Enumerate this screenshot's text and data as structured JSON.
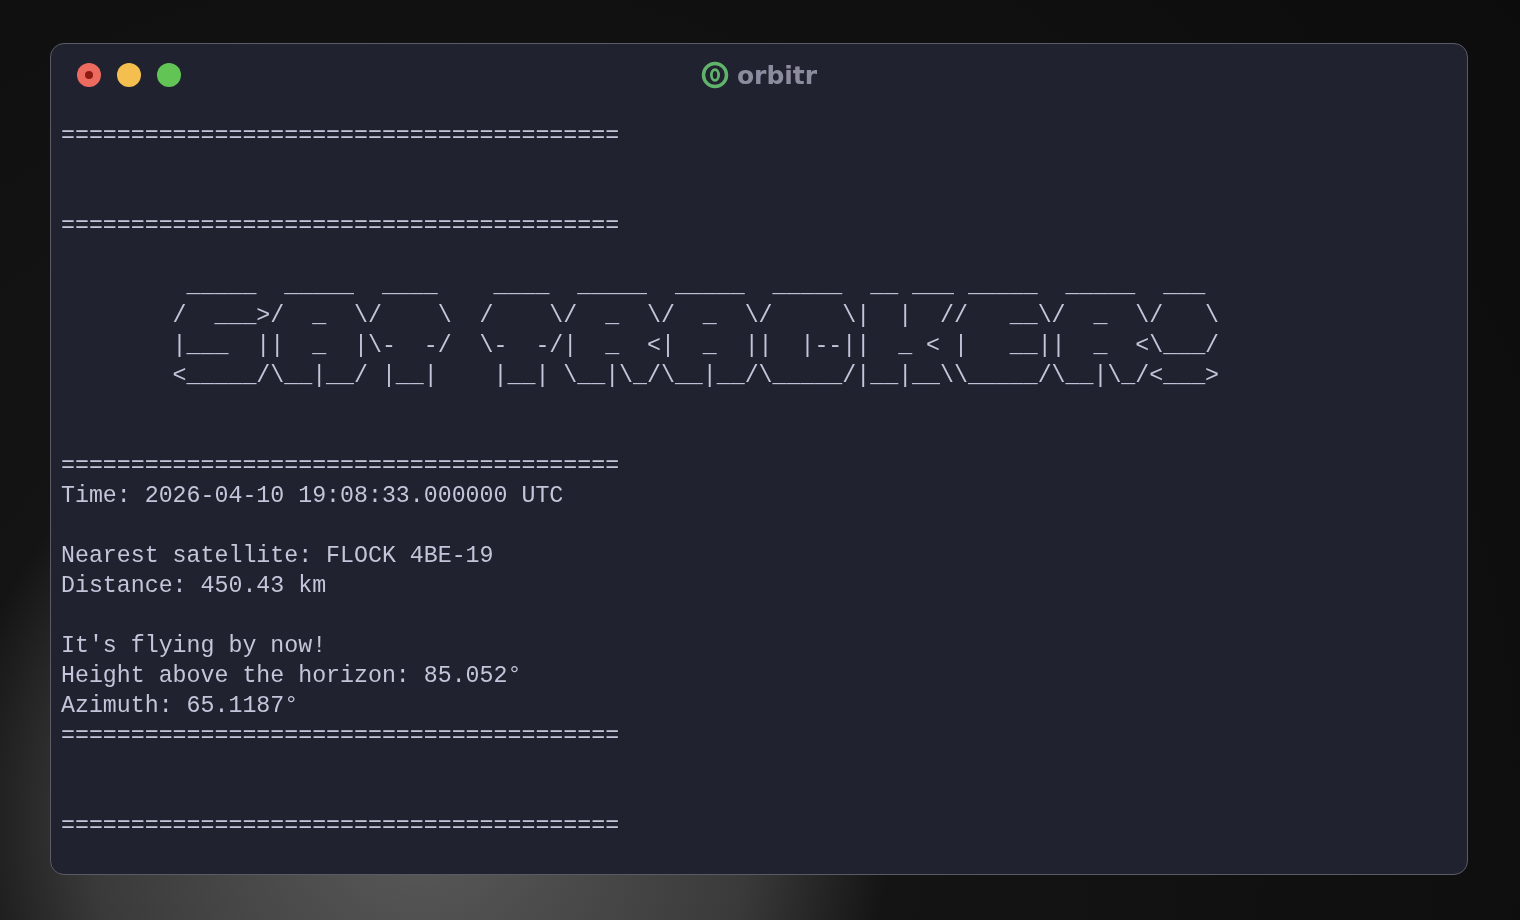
{
  "window": {
    "title": "orbitr"
  },
  "terminal": {
    "lines": [
      {
        "kind": "rule",
        "text": "========================================"
      },
      {
        "kind": "blank"
      },
      {
        "kind": "blank"
      },
      {
        "kind": "rule",
        "text": "========================================"
      },
      {
        "kind": "blank"
      },
      {
        "kind": "art",
        "text": "         _____  _____  ____    ____  _____  _____  _____  __ ___ _____  _____  ___"
      },
      {
        "kind": "art",
        "text": "        /  ___>/  _  \\/    \\  /    \\/  _  \\/  _  \\/     \\|  |  //   __\\/  _  \\/   \\"
      },
      {
        "kind": "art",
        "text": "        |___  ||  _  |\\-  -/  \\-  -/|  _  <|  _  ||  |--||  _ < |   __||  _  <\\___/"
      },
      {
        "kind": "art",
        "text": "        <_____/\\__|__/ |__|    |__| \\__|\\_/\\__|__/\\_____/|__|__\\\\_____/\\__|\\_/<___>"
      },
      {
        "kind": "blank"
      },
      {
        "kind": "blank"
      },
      {
        "kind": "rule",
        "text": "========================================"
      },
      {
        "kind": "text",
        "text": "Time: 2026-04-10 19:08:33.000000 UTC"
      },
      {
        "kind": "blank"
      },
      {
        "kind": "text",
        "text": "Nearest satellite: FLOCK 4BE-19"
      },
      {
        "kind": "text",
        "text": "Distance: 450.43 km"
      },
      {
        "kind": "blank"
      },
      {
        "kind": "text",
        "text": "It's flying by now!"
      },
      {
        "kind": "text",
        "text": "Height above the horizon: 85.052°"
      },
      {
        "kind": "text",
        "text": "Azimuth: 65.1187°"
      },
      {
        "kind": "rule",
        "text": "========================================"
      },
      {
        "kind": "blank"
      },
      {
        "kind": "blank"
      },
      {
        "kind": "rule",
        "text": "========================================"
      }
    ]
  }
}
